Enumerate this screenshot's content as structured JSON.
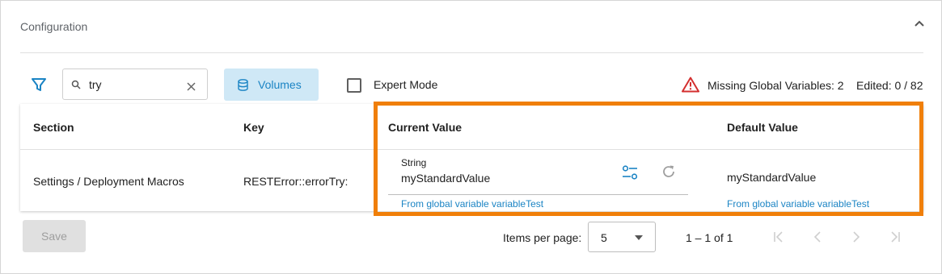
{
  "panel": {
    "title": "Configuration",
    "collapse_icon": "chevron-up-icon"
  },
  "toolbar": {
    "filter_icon": "filter-icon",
    "search": {
      "value": "try",
      "icon": "search-icon",
      "clear_icon": "close-icon"
    },
    "volumes_label": "Volumes",
    "volumes_icon": "database-icon",
    "expert_mode_label": "Expert Mode",
    "expert_mode_checked": false,
    "missing_globals": "Missing Global Variables: 2",
    "edited": "Edited: 0 / 82",
    "warning_color": "#d32f2f"
  },
  "table": {
    "headers": {
      "section": "Section",
      "key": "Key",
      "current_value": "Current Value",
      "default_value": "Default Value"
    },
    "rows": [
      {
        "section": "Settings / Deployment Macros",
        "key": "RESTError::errorTry:",
        "current_type": "String",
        "current_value": "myStandardValue",
        "current_hint": "From global variable variableTest",
        "default_value": "myStandardValue",
        "default_hint": "From global variable variableTest"
      }
    ]
  },
  "footer": {
    "save_label": "Save",
    "items_per_page_label": "Items per page:",
    "items_per_page_value": "5",
    "range_label": "1 – 1 of 1"
  },
  "colors": {
    "accent": "#1b84c4",
    "accent_bg": "#cfe8f6",
    "highlight": "#f07f09"
  }
}
